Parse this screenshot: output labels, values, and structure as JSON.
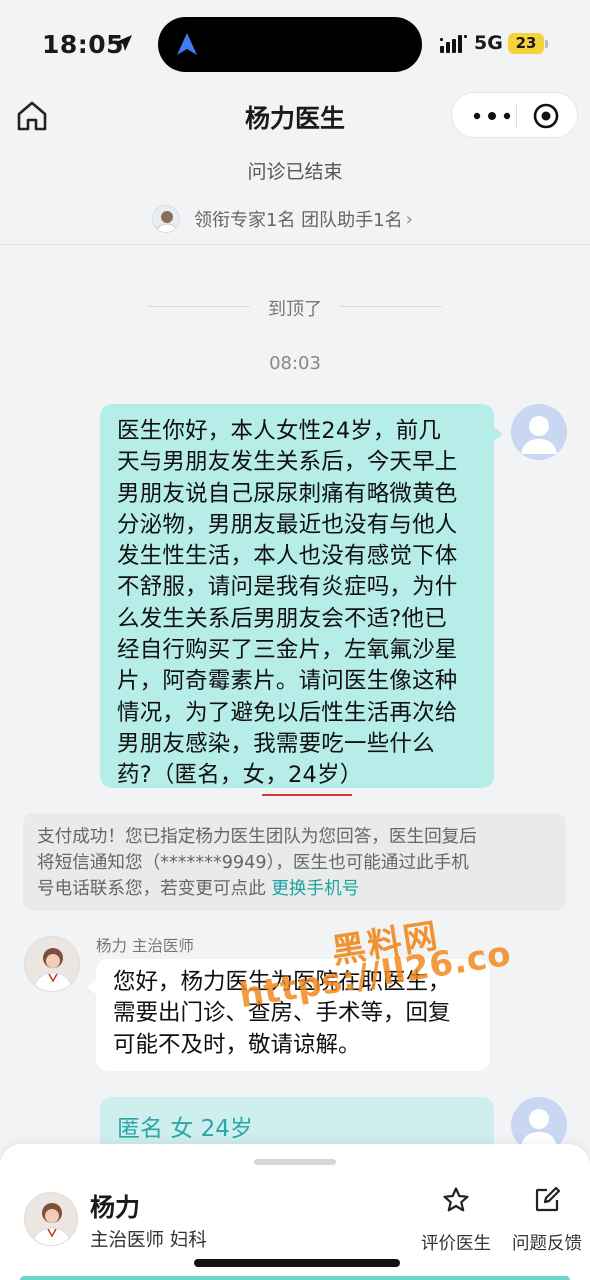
{
  "status_bar": {
    "time": "18:05",
    "network": "5G",
    "battery": "23"
  },
  "nav": {
    "title": "杨力医生"
  },
  "consult": {
    "status": "问诊已结束",
    "team_summary": "领衔专家1名 团队助手1名",
    "team_chevron": "›"
  },
  "chat": {
    "top_label": "到顶了",
    "timestamp": "08:03",
    "user_message_lines": [
      "医生你好，本人女性24岁，前几",
      "天与男朋友发生关系后，今天早上",
      "男朋友说自己尿尿刺痛有略微黄色",
      "分泌物，男朋友最近也没有与他人",
      "发生性生活，本人也没有感觉下体",
      "不舒服，请问是我有炎症吗，为什",
      "么发生关系后男朋友会不适?他已",
      "经自行购买了三金片，左氧氟沙星",
      "片，阿奇霉素片。请问医生像这种",
      "情况，为了避免以后性生活再次给",
      "男朋友感染，我需要吃一些什么",
      "药?（匿名，女，24岁）"
    ],
    "notice_lines": [
      "支付成功！您已指定杨力医生团队为您回答，医生回复后",
      "将短信通知您（*******9949），医生也可能通过此手机",
      "号电话联系您，若变更可点此"
    ],
    "notice_link": "更换手机号",
    "doctor_label": "杨力 主治医师",
    "doctor_message_lines": [
      "您好，杨力医生为医院在职医生，",
      "需要出门诊、查房、手术等，回复",
      "可能不及时，敬请谅解。"
    ],
    "user_card": "匿名 女 24岁"
  },
  "watermark": {
    "brand": "黑料网",
    "url": "https://ll26.co"
  },
  "sheet": {
    "doctor_name": "杨力",
    "doctor_title": "主治医师  妇科",
    "actions": [
      {
        "label": "评价医生",
        "icon": "star-icon"
      },
      {
        "label": "问题反馈",
        "icon": "edit-icon"
      }
    ]
  },
  "colors": {
    "user_bubble": "#b6ede9",
    "accent_teal": "#1aa6a0",
    "watermark": "#f08a1f",
    "background": "#f2f3f5"
  }
}
